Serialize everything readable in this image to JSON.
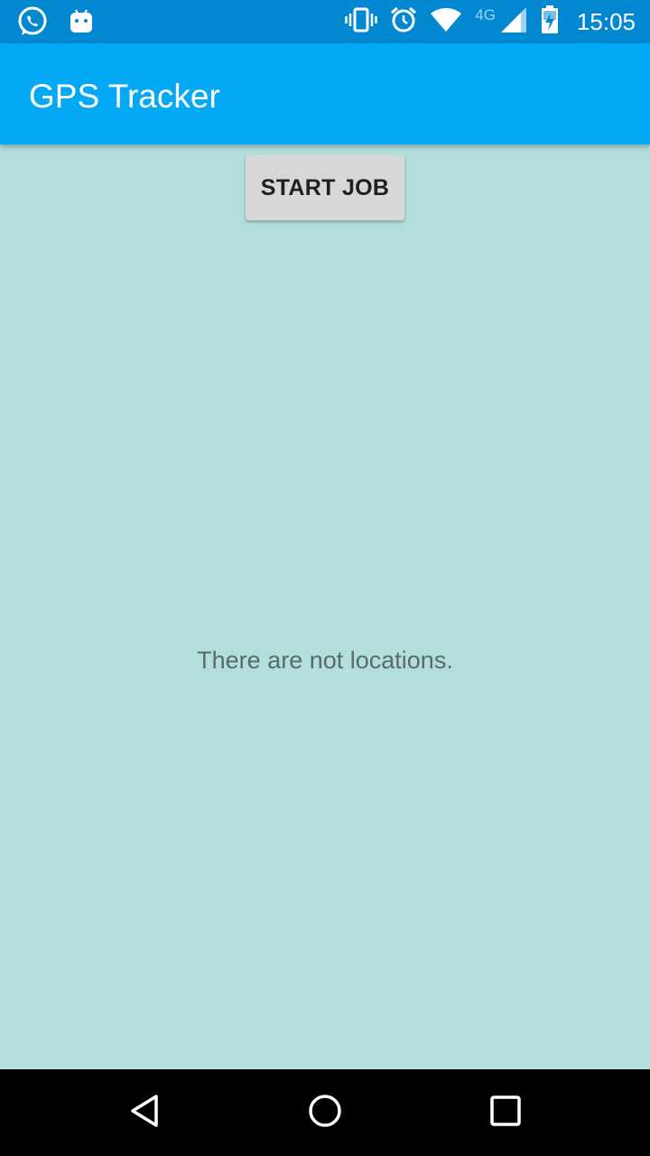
{
  "status_bar": {
    "time": "15:05",
    "network_type": "4G",
    "left_icons": [
      "whatsapp-icon",
      "android-icon"
    ],
    "right_icons": [
      "vibrate-icon",
      "alarm-icon",
      "wifi-icon",
      "cell-signal-icon",
      "battery-charging-icon"
    ]
  },
  "app_bar": {
    "title": "GPS Tracker"
  },
  "main": {
    "start_button_label": "START JOB",
    "empty_message": "There are not locations."
  },
  "nav_bar": {
    "icons": [
      "back-icon",
      "home-icon",
      "recents-icon"
    ]
  },
  "colors": {
    "status_bar": "#0288d1",
    "app_bar": "#03a9f4",
    "background": "#b2dfdb",
    "button": "#d6d7d7"
  }
}
